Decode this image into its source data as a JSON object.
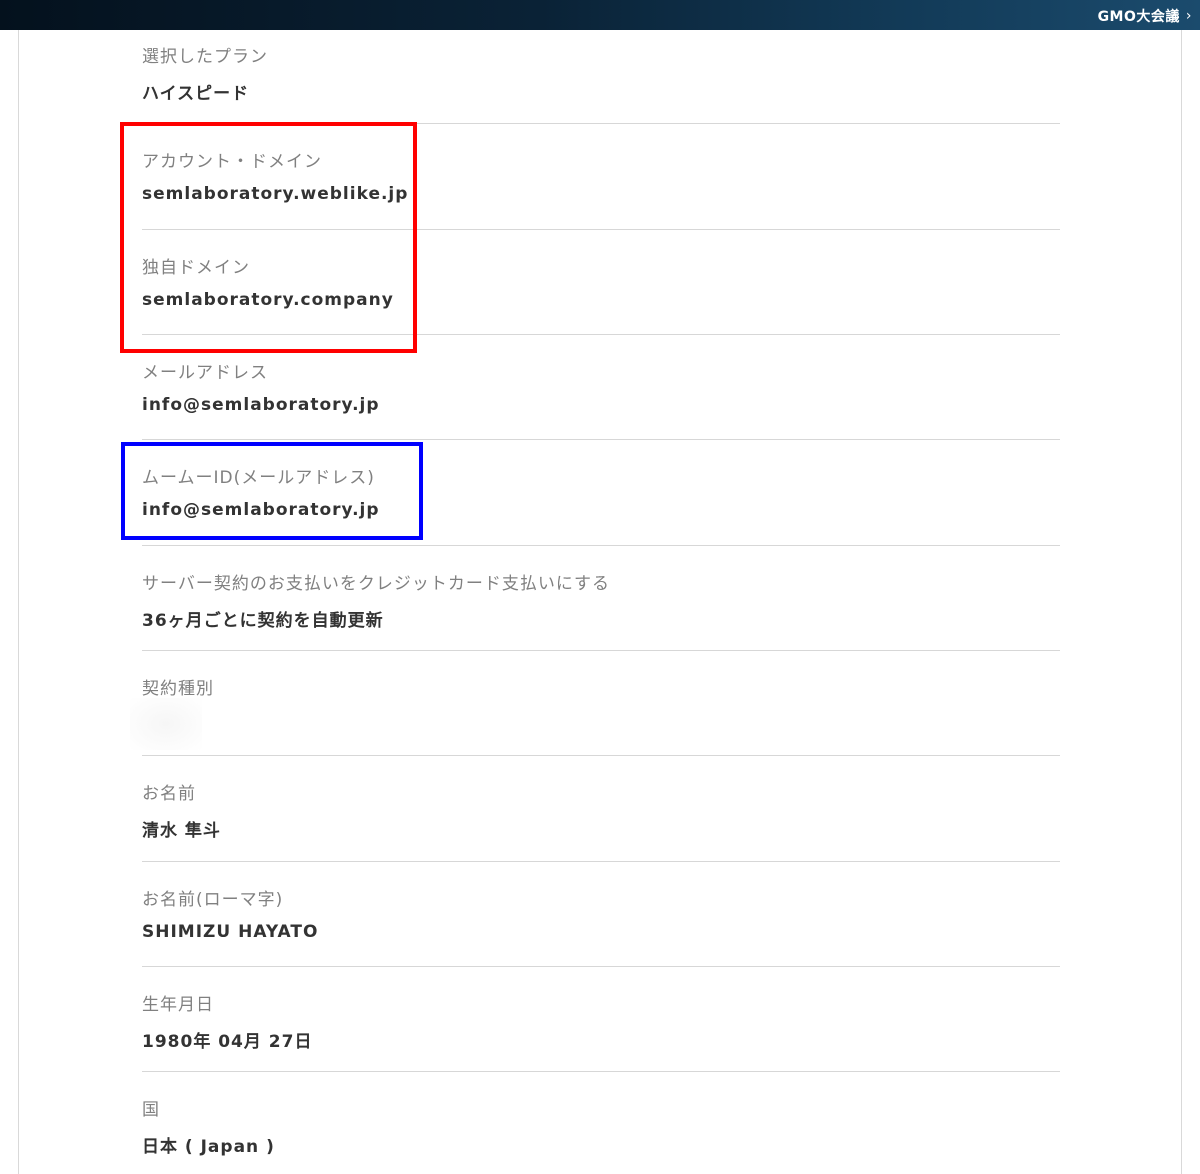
{
  "header": {
    "brand_label": "GMO大会議",
    "chevron": "›"
  },
  "fields": [
    {
      "label": "選択したプラン",
      "value": "ハイスピード"
    },
    {
      "label": "アカウント・ドメイン",
      "value": "semlaboratory.weblike.jp"
    },
    {
      "label": "独自ドメイン",
      "value": "semlaboratory.company"
    },
    {
      "label": "メールアドレス",
      "value": "info@semlaboratory.jp"
    },
    {
      "label": "ムームーID(メールアドレス)",
      "value": "info@semlaboratory.jp"
    },
    {
      "label": "サーバー契約のお支払いをクレジットカード支払いにする",
      "value": "36ヶ月ごとに契約を自動更新"
    },
    {
      "label": "契約種別",
      "value": ""
    },
    {
      "label": "お名前",
      "value": "清水 隼斗"
    },
    {
      "label": "お名前(ローマ字)",
      "value": "SHIMIZU HAYATO"
    },
    {
      "label": "生年月日",
      "value": "1980年 04月 27日"
    },
    {
      "label": "国",
      "value": "日本 ( Japan )"
    }
  ],
  "highlights": {
    "red_box_color": "#ff0000",
    "blue_box_color": "#0000ff"
  }
}
